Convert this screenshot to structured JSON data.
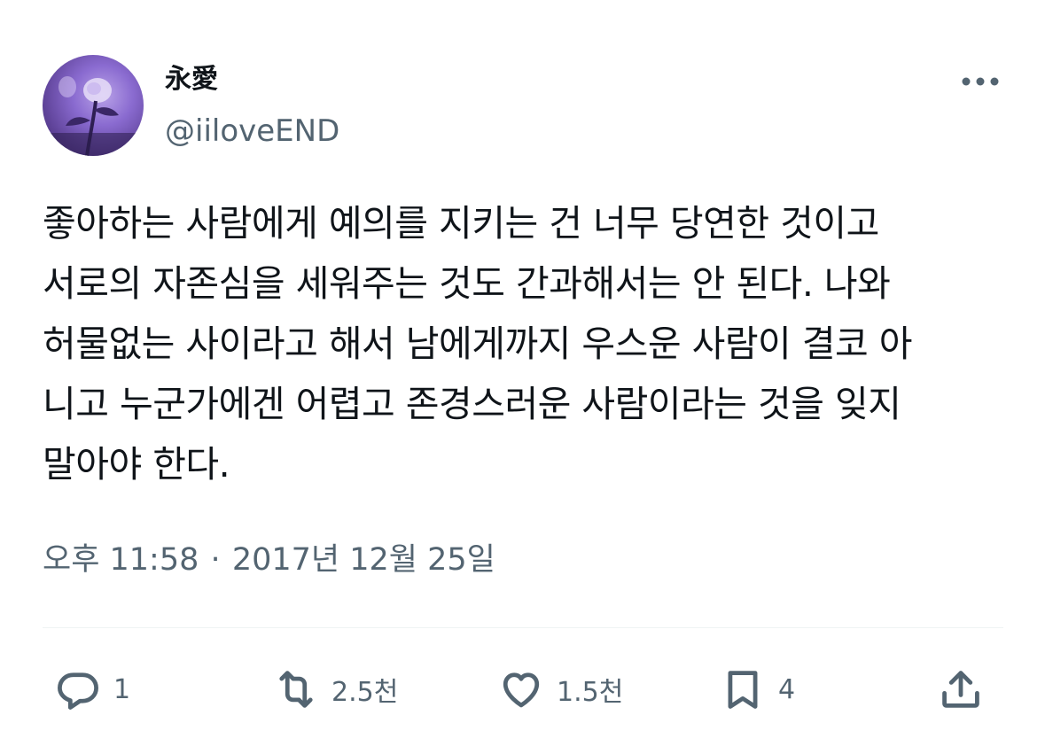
{
  "author": {
    "display_name": "永愛",
    "handle": "@iiloveEND",
    "avatar_icon": "avatar-rose-photo"
  },
  "more_icon": "more-dots-icon",
  "tweet": {
    "text": "좋아하는 사람에게 예의를 지키는 건 너무 당연한 것이고\n서로의 자존심을 세워주는 것도 간과해서는 안 된다. 나와\n허물없는 사이라고 해서 남에게까지 우스운 사람이 결코 아\n니고 누군가에겐 어렵고 존경스러운 사람이라는 것을 잊지\n말아야 한다."
  },
  "timestamp": {
    "time": "오후 11:58",
    "separator": "·",
    "date": "2017년 12월 25일"
  },
  "actions": {
    "reply": {
      "icon": "reply-bubble-icon",
      "count": "1"
    },
    "retweet": {
      "icon": "retweet-icon",
      "count": "2.5천"
    },
    "like": {
      "icon": "heart-icon",
      "count": "1.5천"
    },
    "bookmark": {
      "icon": "bookmark-icon",
      "count": "4"
    },
    "share": {
      "icon": "share-icon"
    }
  },
  "colors": {
    "text_primary": "#0f1419",
    "text_secondary": "#536471",
    "divider": "#eff3f4",
    "avatar_tint": "#8a6bd0"
  }
}
